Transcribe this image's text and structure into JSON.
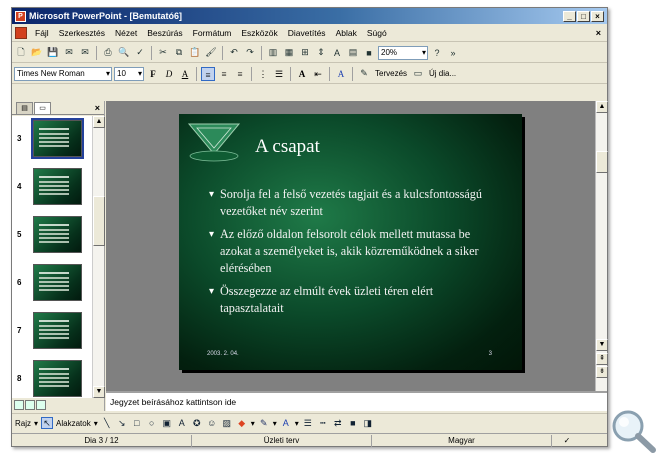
{
  "window": {
    "title": "Microsoft PowerPoint - [Bemutató6]",
    "buttons": [
      "_",
      "□",
      "×"
    ]
  },
  "menu": {
    "items": [
      "Fájl",
      "Szerkesztés",
      "Nézet",
      "Beszúrás",
      "Formátum",
      "Eszközök",
      "Diavetítés",
      "Ablak",
      "Súgó"
    ],
    "close": "×"
  },
  "toolbar": {
    "zoom": "20%"
  },
  "format_toolbar": {
    "font": "Times New Roman",
    "size": "10",
    "bold": "F",
    "italic": "D",
    "underline": "A",
    "design_label": "Tervezés",
    "new_slide_label": "Új dia..."
  },
  "left_pane": {
    "close": "×",
    "slides": [
      "3",
      "4",
      "5",
      "6",
      "7",
      "8"
    ],
    "selected": "3"
  },
  "slide": {
    "title": "A csapat",
    "bullets": [
      "Sorolja fel a felső vezetés tagjait és a kulcsfontosságú vezetőket név szerint",
      "Az előző oldalon felsorolt célok mellett mutassa be azokat a személyeket is, akik közreműködnek a siker elérésében",
      "Összegezze az elmúlt évek üzleti téren elért tapasztalatait"
    ],
    "date": "2003. 2. 04.",
    "number": "3"
  },
  "notes": {
    "placeholder": "Jegyzet beírásához kattintson ide"
  },
  "draw_toolbar": {
    "draw_label": "Rajz",
    "autoshapes_label": "Alakzatok"
  },
  "status": {
    "slide": "Dia 3 / 12",
    "design": "Üzleti terv",
    "language": "Magyar"
  },
  "colors": {
    "title_bar": "#0a246a",
    "slide_bg": "#0b4a2a",
    "workspace": "#808080"
  }
}
